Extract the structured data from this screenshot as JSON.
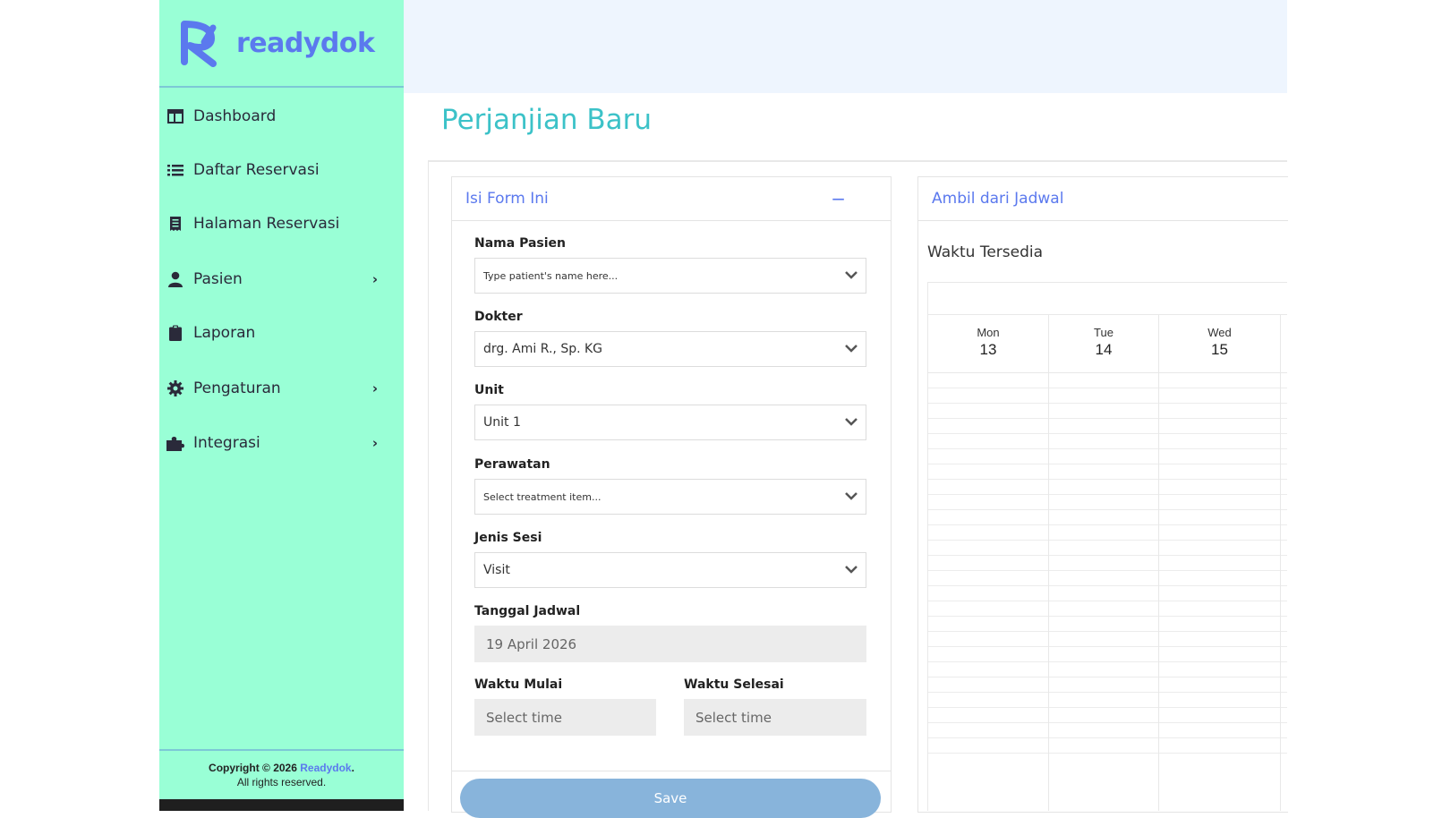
{
  "brand": {
    "name": "readydok",
    "color": "#5b79ee"
  },
  "sidebar": {
    "items": [
      {
        "label": "Dashboard",
        "icon": "dashboard-icon",
        "has_children": false
      },
      {
        "label": "Daftar Reservasi",
        "icon": "list-icon",
        "has_children": false
      },
      {
        "label": "Halaman Reservasi",
        "icon": "receipt-icon",
        "has_children": false
      },
      {
        "label": "Pasien",
        "icon": "user-icon",
        "has_children": true
      },
      {
        "label": "Laporan",
        "icon": "clipboard-icon",
        "has_children": false
      },
      {
        "label": "Pengaturan",
        "icon": "gear-icon",
        "has_children": true
      },
      {
        "label": "Integrasi",
        "icon": "puzzle-icon",
        "has_children": true
      }
    ],
    "footer": {
      "copyright": "Copyright © 2026",
      "brand": "Readydok",
      "period": ".",
      "rights": "All rights reserved."
    }
  },
  "page": {
    "title": "Perjanjian Baru"
  },
  "form_card": {
    "title": "Isi Form Ini",
    "collapse_label": "−",
    "fields": {
      "patient": {
        "label": "Nama Pasien",
        "placeholder": "Type patient's name here..."
      },
      "doctor": {
        "label": "Dokter",
        "value": "drg. Ami R., Sp. KG"
      },
      "unit": {
        "label": "Unit",
        "value": "Unit 1"
      },
      "treatment": {
        "label": "Perawatan",
        "placeholder": "Select treatment item..."
      },
      "session_type": {
        "label": "Jenis Sesi",
        "value": "Visit"
      },
      "date": {
        "label": "Tanggal Jadwal",
        "value": "19 April 2026"
      },
      "start_time": {
        "label": "Waktu Mulai",
        "placeholder": "Select time"
      },
      "end_time": {
        "label": "Waktu Selesai",
        "placeholder": "Select time"
      }
    },
    "save_label": "Save"
  },
  "schedule_card": {
    "title": "Ambil dari Jadwal",
    "subtitle": "Waktu Tersedia",
    "days": [
      {
        "name": "Mon",
        "num": "13"
      },
      {
        "name": "Tue",
        "num": "14"
      },
      {
        "name": "Wed",
        "num": "15"
      }
    ]
  },
  "colors": {
    "sidebar_bg": "#99ffd6",
    "title_teal": "#3cc2c8",
    "accent_blue": "#5b79ee",
    "save_button": "#88b4db",
    "topbar_bg": "#eef5fe"
  }
}
